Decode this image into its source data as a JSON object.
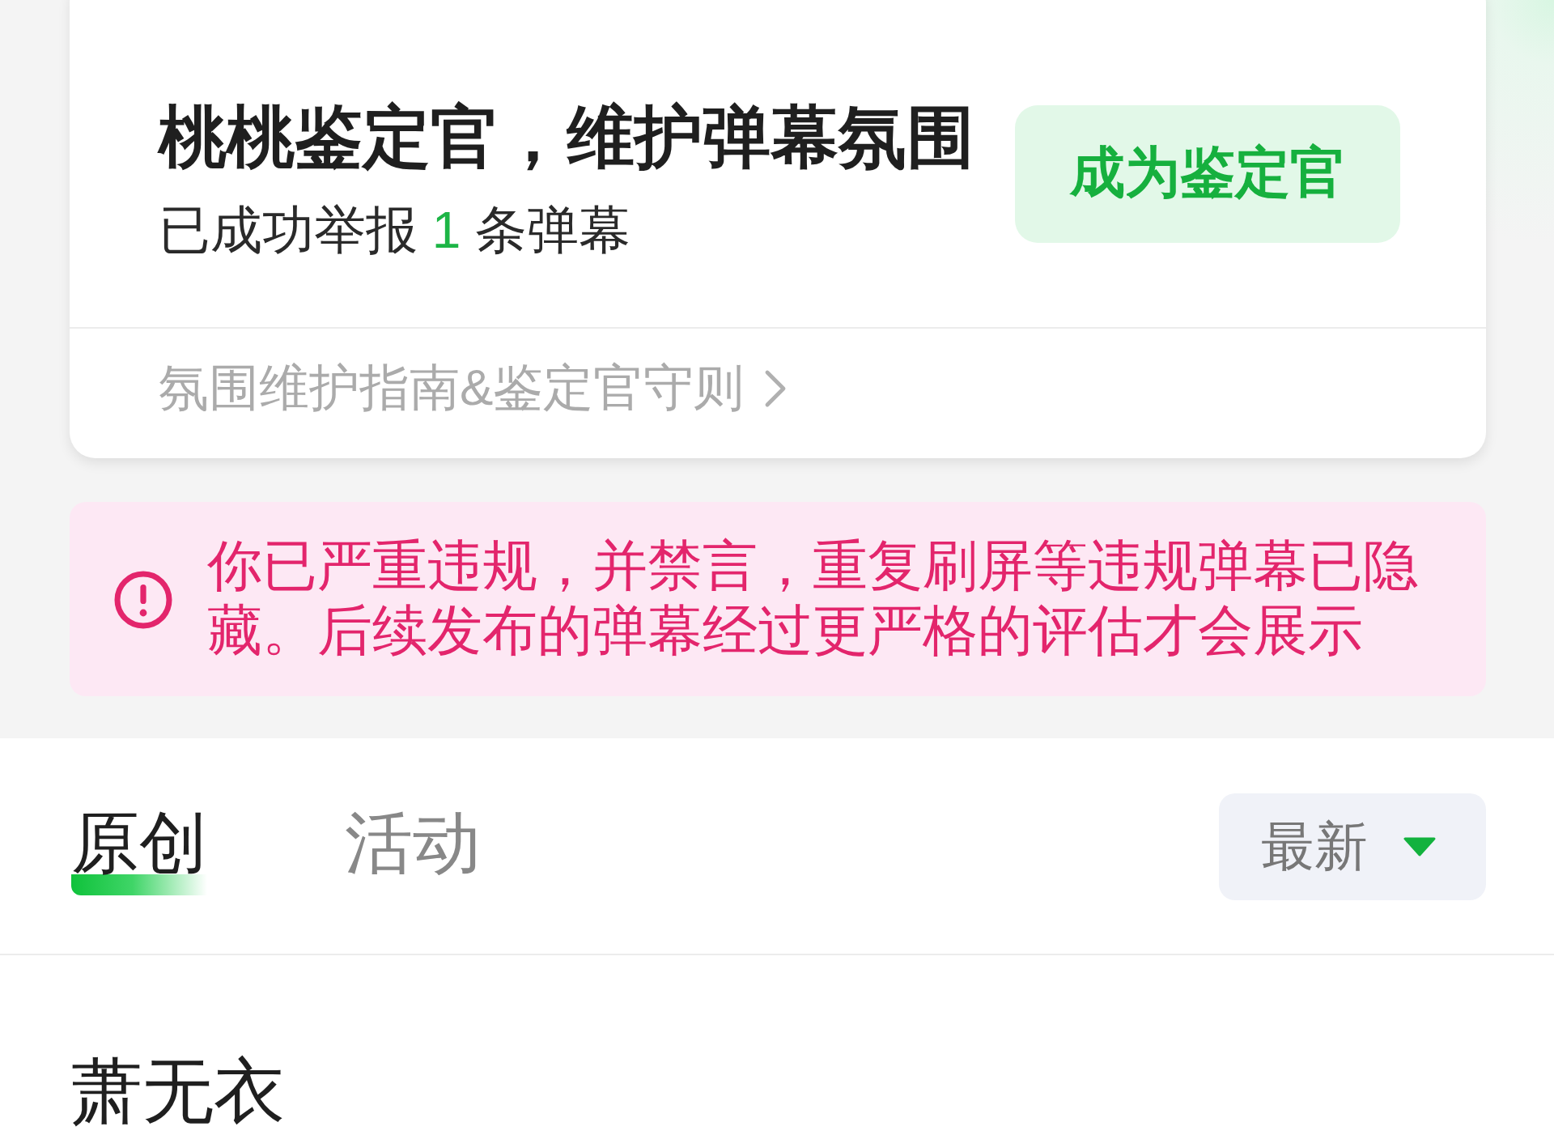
{
  "appraiser_card": {
    "title": "桃桃鉴定官，维护弹幕氛围",
    "report_prefix": "已成功举报",
    "report_count": "1",
    "report_suffix": "条弹幕",
    "button": "成为鉴定官",
    "guide_link": "氛围维护指南&鉴定官守则"
  },
  "notice": {
    "text": "你已严重违规，并禁言，重复刷屏等违规弹幕已隐藏。后续发布的弹幕经过更严格的评估才会展示"
  },
  "tabs": [
    {
      "label": "原创",
      "selected": true
    },
    {
      "label": "活动",
      "selected": false
    }
  ],
  "sort_dropdown": {
    "value": "最新"
  },
  "list": [
    {
      "title": "萧无衣"
    }
  ]
}
